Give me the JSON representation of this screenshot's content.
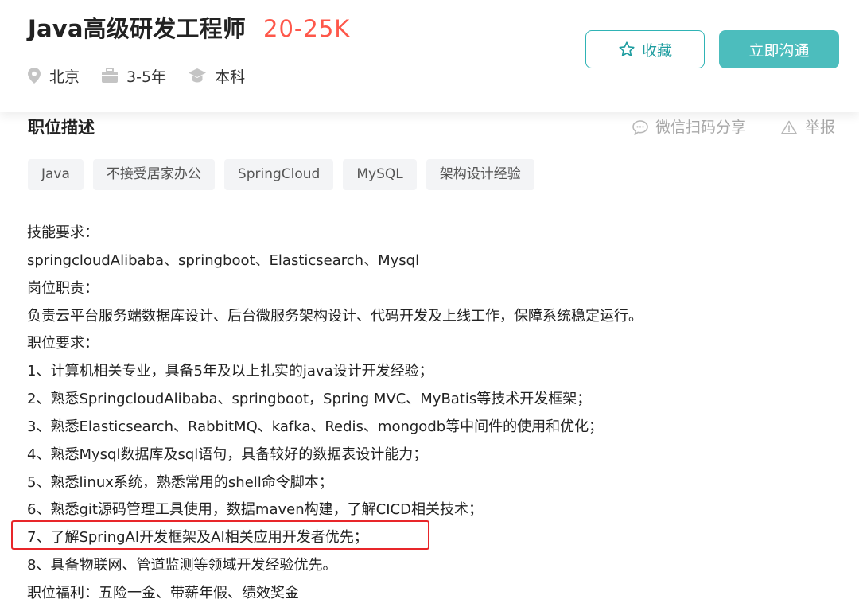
{
  "job": {
    "title": "Java高级研发工程师",
    "salary": "20-25K",
    "meta": {
      "location": "北京",
      "experience": "3-5年",
      "education": "本科"
    }
  },
  "actions": {
    "favorite_label": "收藏",
    "chat_label": "立即沟通"
  },
  "section": {
    "title": "职位描述",
    "share_label": "微信扫码分享",
    "report_label": "举报"
  },
  "tags": [
    "Java",
    "不接受居家办公",
    "SpringCloud",
    "MySQL",
    "架构设计经验"
  ],
  "description": [
    "技能要求：",
    "springcloudAlibaba、springboot、Elasticsearch、Mysql",
    "岗位职责：",
    "负责云平台服务端数据库设计、后台微服务架构设计、代码开发及上线工作，保障系统稳定运行。",
    "职位要求：",
    "1、计算机相关专业，具备5年及以上扎实的java设计开发经验；",
    "2、熟悉SpringcloudAlibaba、springboot，Spring MVC、MyBatis等技术开发框架；",
    "3、熟悉Elasticsearch、RabbitMQ、kafka、Redis、mongodb等中间件的使用和优化；",
    "4、熟悉Mysql数据库及sql语句，具备较好的数据表设计能力；",
    "5、熟悉linux系统，熟悉常用的shell命令脚本；",
    "6、熟悉git源码管理工具使用，数据maven构建，了解CICD相关技术；",
    "7、了解SpringAI开发框架及AI相关应用开发者优先；",
    "8、具备物联网、管道监测等领域开发经验优先。",
    "职位福利：五险一金、带薪年假、绩效奖金"
  ],
  "colors": {
    "salary": "#fe574a",
    "accent": "#4cbdbd",
    "highlight": "#e8262a"
  }
}
